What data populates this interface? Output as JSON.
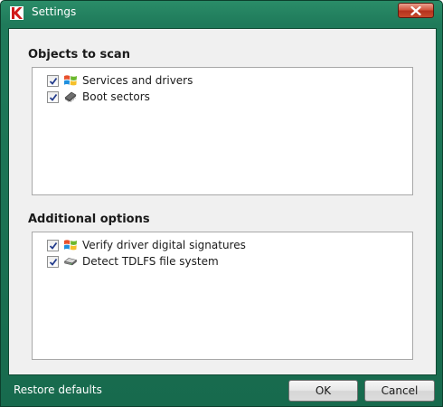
{
  "window": {
    "title": "Settings"
  },
  "sections": {
    "objects": {
      "title": "Objects to scan",
      "items": [
        {
          "label": "Services and drivers",
          "checked": true,
          "icon": "windows-flag-icon"
        },
        {
          "label": "Boot sectors",
          "checked": true,
          "icon": "chip-icon"
        }
      ]
    },
    "additional": {
      "title": "Additional options",
      "items": [
        {
          "label": "Verify driver digital signatures",
          "checked": true,
          "icon": "windows-flag-icon"
        },
        {
          "label": "Detect TDLFS file system",
          "checked": true,
          "icon": "hard-drive-icon"
        }
      ]
    }
  },
  "footer": {
    "restore": "Restore defaults",
    "ok": "OK",
    "cancel": "Cancel"
  },
  "colors": {
    "frame": "#1f7a5a",
    "close": "#c8452a"
  }
}
